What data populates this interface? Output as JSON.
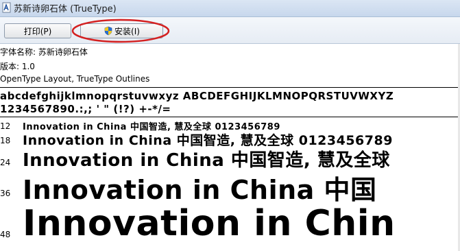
{
  "window": {
    "title": "苏新诗卵石体 (TrueType)"
  },
  "toolbar": {
    "print_label": "打印(P)",
    "install_label": "安装(I)"
  },
  "info": {
    "font_name": "字体名称: 苏新诗卵石体",
    "version": "版本: 1.0",
    "outlines": "OpenType Layout, TrueType Outlines"
  },
  "charset": {
    "line1": "abcdefghijklmnopqrstuvwxyz  ABCDEFGHIJKLMNOPQRSTUVWXYZ",
    "line2": "1234567890.:,; ' \" (!?) +-*/="
  },
  "samples": [
    {
      "size": "12",
      "text": "Innovation in China 中国智造, 慧及全球 0123456789"
    },
    {
      "size": "18",
      "text": "Innovation in China 中国智造, 慧及全球 0123456789"
    },
    {
      "size": "24",
      "text": "Innovation in China 中国智造, 慧及全球"
    },
    {
      "size": "36",
      "text": "Innovation in China 中国"
    },
    {
      "size": "48",
      "text": "Innovation in Chin"
    }
  ],
  "colors": {
    "highlight": "#d42020",
    "shield_blue": "#2a6fd1",
    "shield_yellow": "#f2c81c"
  }
}
